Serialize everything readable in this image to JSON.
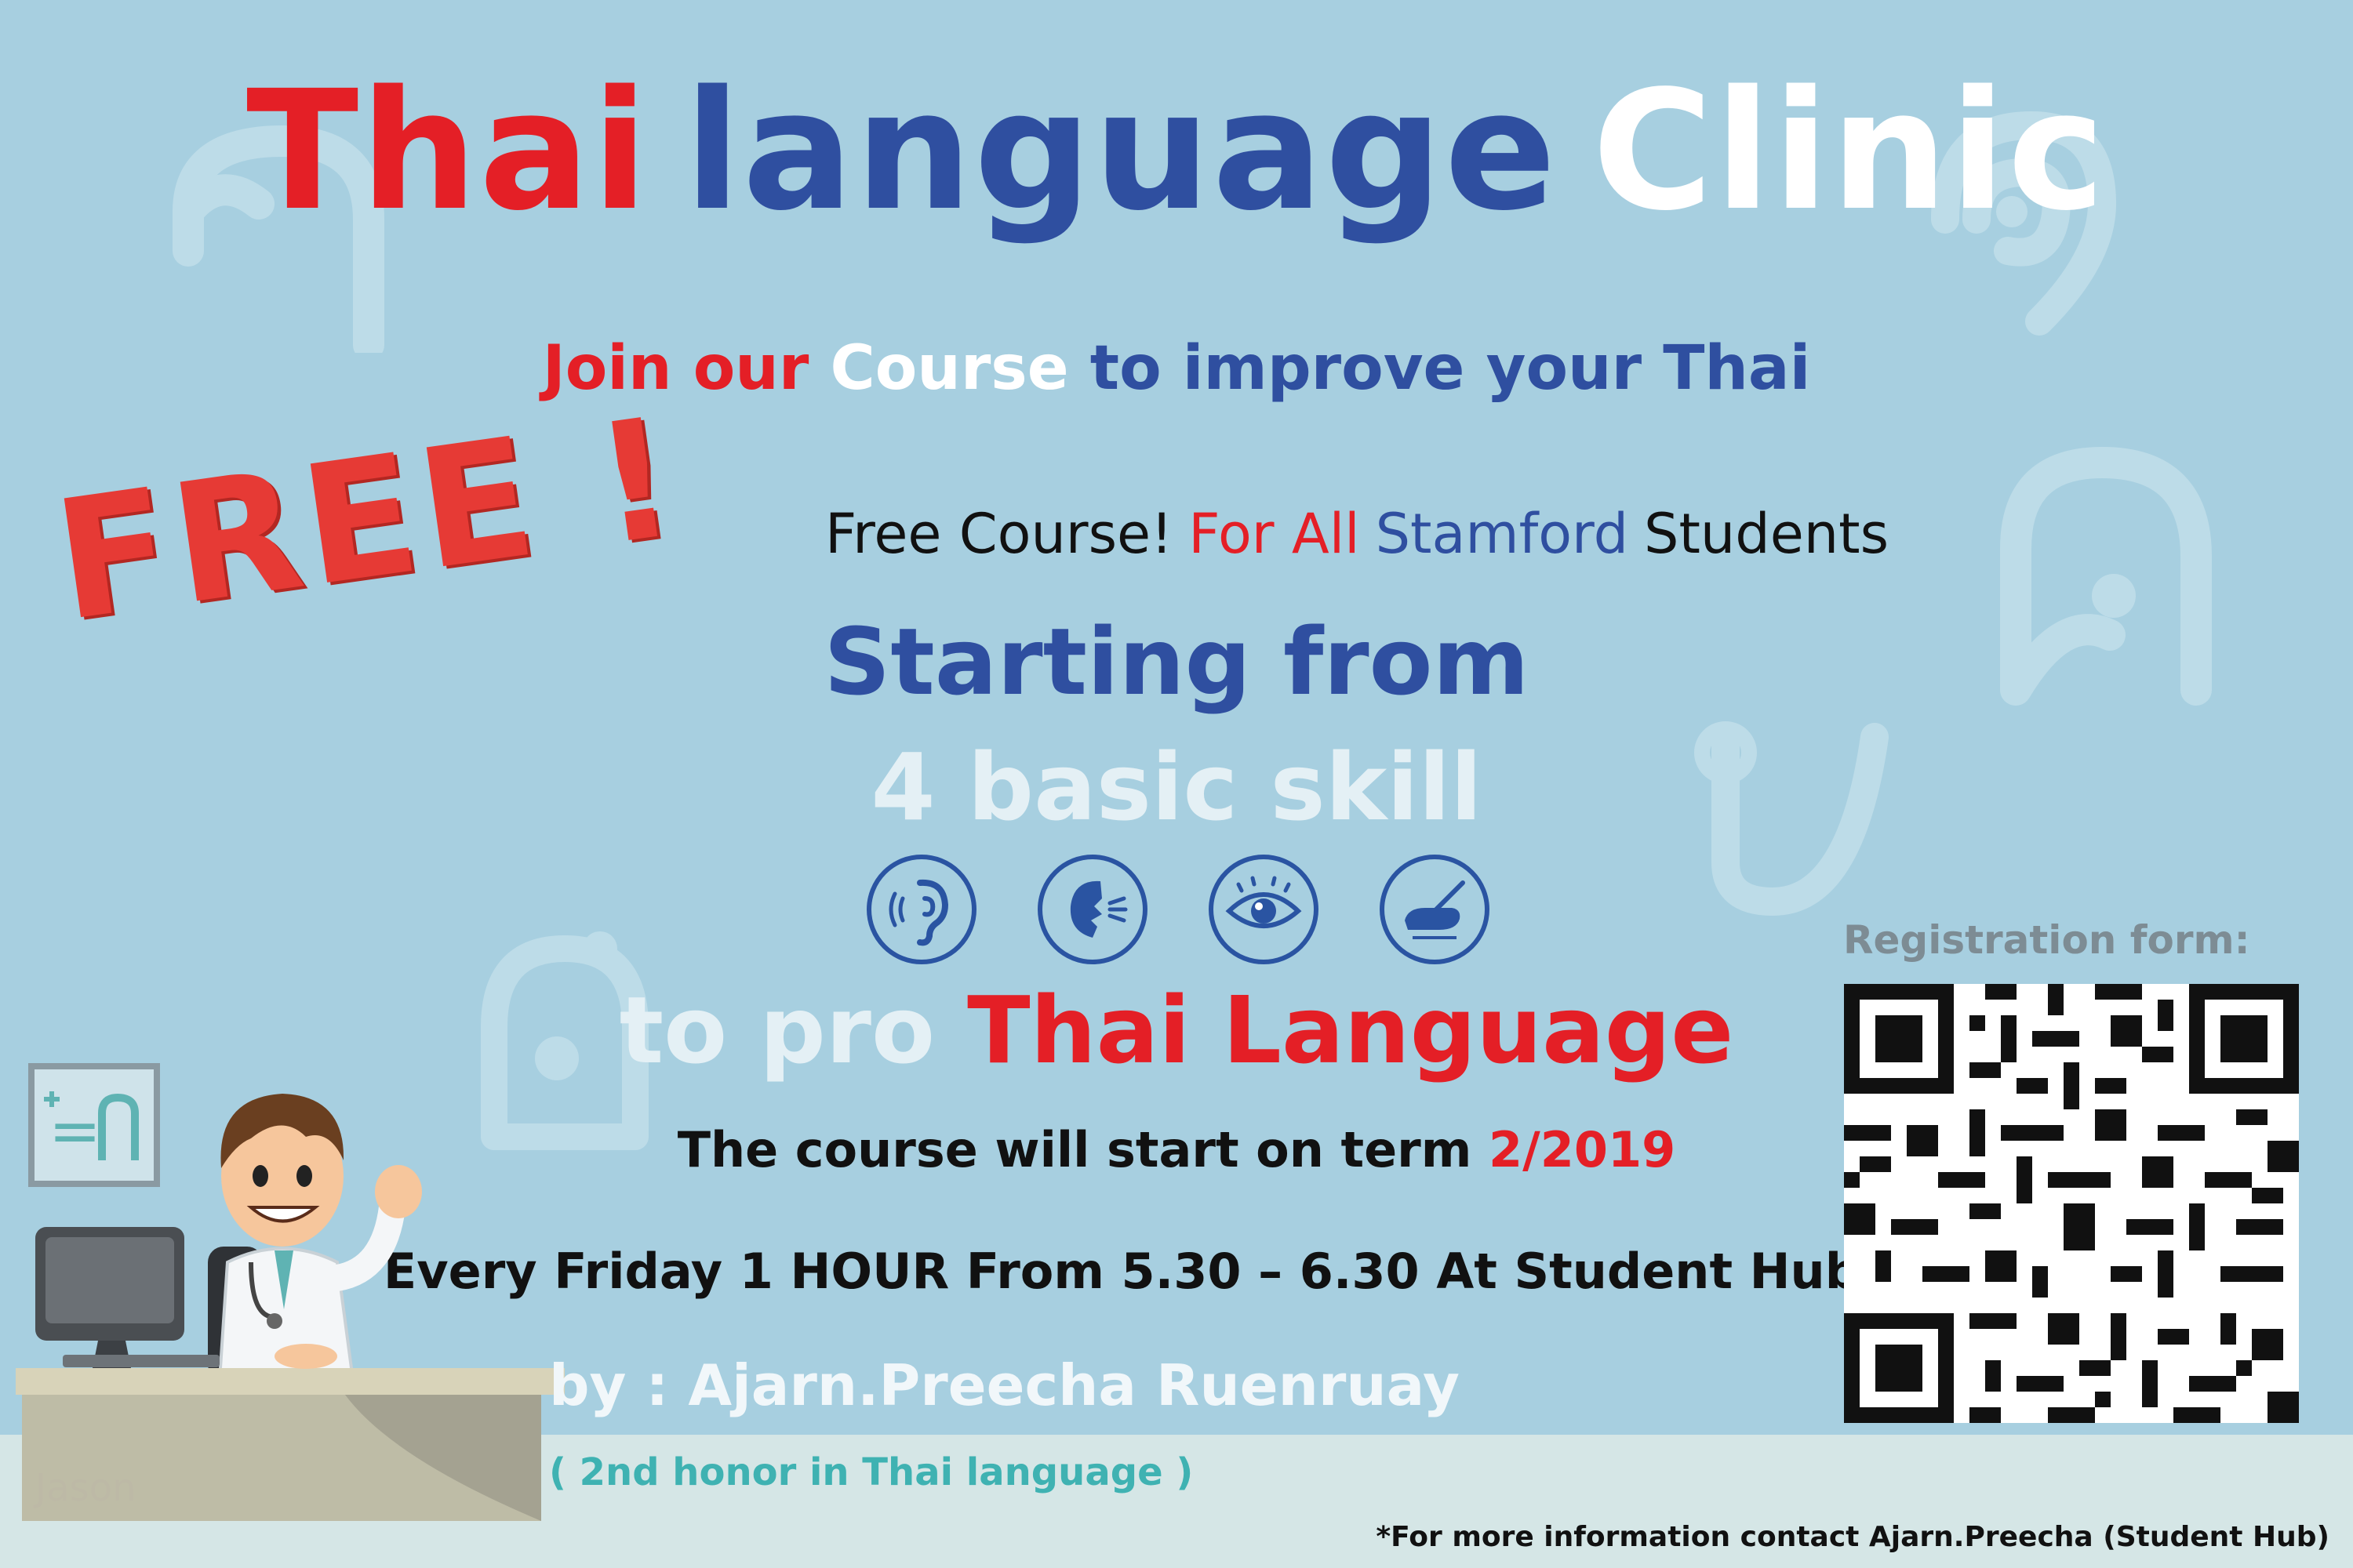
{
  "title": {
    "word1": "Thai",
    "word2": "language",
    "word3": "Clinic"
  },
  "subtitle": {
    "part1": "Join our",
    "part2": "Course",
    "part3": "to improve your Thai"
  },
  "free_stamp": "FREE !",
  "free_line": {
    "part1": "Free Course!",
    "part2": "For All",
    "part3": "Stamford",
    "part4": "Students"
  },
  "starting": "Starting from",
  "skills_title": "4 basic skill",
  "skills": [
    "listening-icon",
    "speaking-icon",
    "reading-icon",
    "writing-icon"
  ],
  "pro_line": {
    "part1": "to pro",
    "part2": "Thai Language"
  },
  "term_line": {
    "text": "The course will start on term",
    "term": "2/2019"
  },
  "schedule": "Every Friday 1 HOUR From 5.30 – 6.30 At Student Hub",
  "teacher": "by : Ajarn.Preecha Ruenruay",
  "honor": "( 2nd honor in Thai language )",
  "registration_label": "Registration form:",
  "contact": "*For more information contact Ajarn.Preecha (Student Hub)",
  "illustration_signature": "Jason",
  "colors": {
    "background": "#a7cfe0",
    "red": "#e41f26",
    "blue": "#2f4fa0",
    "white": "#ffffff",
    "teal": "#3fb2b2"
  }
}
